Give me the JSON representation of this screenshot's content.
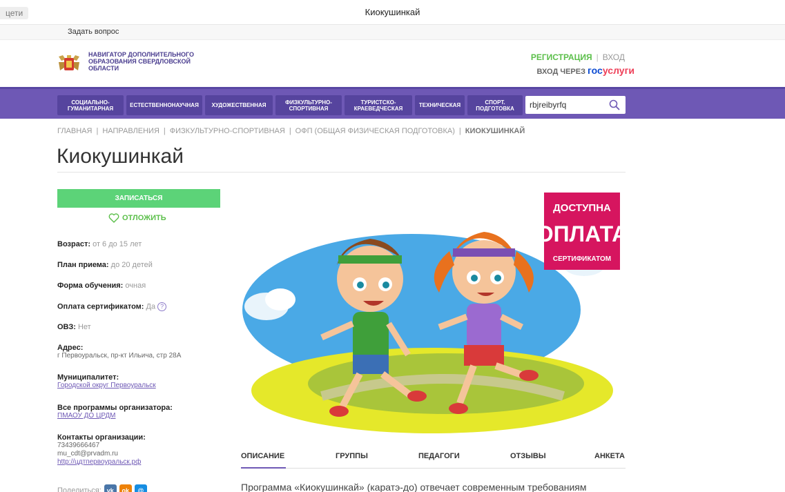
{
  "browser": {
    "tab_stub": "цети",
    "window_title": "Киокушинкай"
  },
  "topbar": {
    "ask_question": "Задать вопрос"
  },
  "header": {
    "logo_text_1": "Навигатор дополнительного",
    "logo_text_2": "образования Свердловской",
    "logo_text_3": "области",
    "register": "Регистрация",
    "separator": "|",
    "login": "Вход",
    "login_via": "ВХОД ЧЕРЕЗ",
    "gos_1": "гос",
    "gos_2": "услуги"
  },
  "nav": {
    "items": [
      "Социально-гуманитарная",
      "Естественнонаучная",
      "Художественная",
      "Физкультурно-спортивная",
      "Туристско-краеведческая",
      "Техническая",
      "Спорт. подготовка"
    ],
    "search_value": "rbjreibyrfq"
  },
  "breadcrumb": {
    "items": [
      "Главная",
      "Направления",
      "Физкультурно-спортивная",
      "ОФП (общая физическая подготовка)"
    ],
    "current": "Киокушинкай",
    "sep": "|"
  },
  "page": {
    "title": "Киокушинкай"
  },
  "sidebar": {
    "enroll": "Записаться",
    "postpone": "Отложить",
    "age_label": "Возраст:",
    "age_value": "от 6 до 15 лет",
    "plan_label": "План приема:",
    "plan_value": "до 20 детей",
    "form_label": "Форма обучения:",
    "form_value": "очная",
    "cert_label": "Оплата сертификатом:",
    "cert_value": "Да",
    "ovz_label": "ОВЗ:",
    "ovz_value": "Нет",
    "address_label": "Адрес:",
    "address_value": "г Первоуральск, пр-кт Ильича, стр 28А",
    "municipality_label": "Муниципалитет:",
    "municipality_value": "Городской округ Первоуральск",
    "programs_label": "Все программы организатора:",
    "programs_value": "ПМАОУ ДО ЦРДМ",
    "contacts_label": "Контакты организации:",
    "contacts_phone": "73439666467",
    "contacts_email": "mu_cdt@prvadm.ru",
    "contacts_site": "http://цдтпервоуральск.рф",
    "share_label": "Поделиться:"
  },
  "promo_badge": {
    "line1": "ДОСТУПНА",
    "line2": "ОПЛАТА",
    "line3": "СЕРТИФИКАТОМ"
  },
  "tabs": [
    "Описание",
    "Группы",
    "Педагоги",
    "Отзывы",
    "Анкета"
  ],
  "description": "Программа «Киокушинкай» (каратэ-до) отвечает современным требованиям",
  "colors": {
    "brand_purple": "#6e58b5",
    "brand_green": "#5cd378",
    "badge_red": "#d6155f"
  }
}
